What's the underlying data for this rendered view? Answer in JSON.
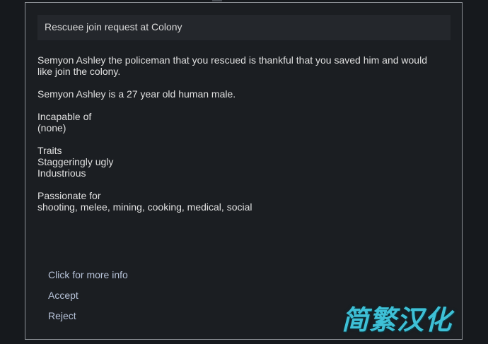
{
  "dialog": {
    "title": "Rescuee join request at Colony",
    "paragraphs": [
      "Semyon Ashley the policeman that you rescued is thankful that you saved him and would like join the colony.",
      "Semyon Ashley is a 27 year old human male.",
      "Incapable of\n(none)",
      "Traits\nStaggeringly ugly\nIndustrious",
      "Passionate for\nshooting, melee, mining, cooking, medical, social"
    ],
    "options": [
      "Click for more info",
      "Accept",
      "Reject"
    ]
  },
  "watermark": "简繁汉化",
  "colors": {
    "background": "#16191d",
    "dialog_background": "#1b1e22",
    "title_bar": "#24272c",
    "option_text": "#b7c3d9",
    "watermark": "#3ec0d6"
  }
}
